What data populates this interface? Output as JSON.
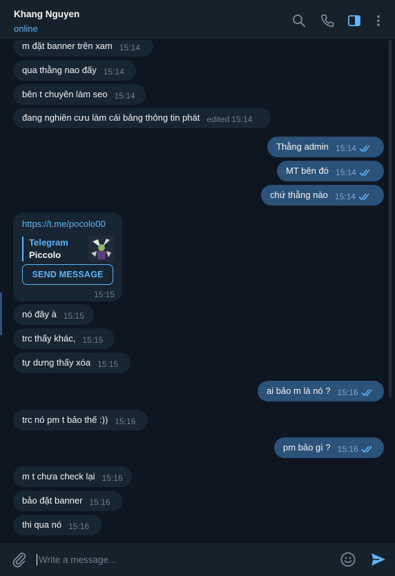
{
  "header": {
    "name": "Khang Nguyen",
    "status": "online",
    "icons": [
      "search-icon",
      "phone-icon",
      "sidebar-toggle-icon",
      "more-vertical-icon"
    ]
  },
  "messages": [
    {
      "dir": "in",
      "text": "m đặt banner trên xam",
      "time": "15:14"
    },
    {
      "dir": "in",
      "text": "qua thằng nao đấy",
      "time": "15:14"
    },
    {
      "dir": "in",
      "text": "bên t chuyên làm seo",
      "time": "15:14"
    },
    {
      "dir": "in",
      "text": "đang nghiên cưu làm cái bảng thông tin phát",
      "time": "edited 15:14"
    },
    {
      "dir": "out",
      "text": "Thằng admin",
      "time": "15:14",
      "read": true
    },
    {
      "dir": "out",
      "text": "MT bên đó",
      "time": "15:14",
      "read": true
    },
    {
      "dir": "out",
      "text": "chứ thằng nào",
      "time": "15:14",
      "read": true
    },
    {
      "dir": "in",
      "text": "nó đây à",
      "time": "15:15"
    },
    {
      "dir": "in",
      "text": "trc thấy khác,",
      "time": "15:15"
    },
    {
      "dir": "in",
      "text": "tự dưng thấy xóa",
      "time": "15:15"
    },
    {
      "dir": "out",
      "text": "ai bảo m là nó ?",
      "time": "15:16",
      "read": true
    },
    {
      "dir": "in",
      "text": "trc nó pm t bảo thế :))",
      "time": "15:16"
    },
    {
      "dir": "out",
      "text": "pm bảo gì ?",
      "time": "15:16",
      "read": true
    },
    {
      "dir": "in",
      "text": "m t chưa check lại",
      "time": "15:16"
    },
    {
      "dir": "in",
      "text": "bảo đặt banner",
      "time": "15:16"
    },
    {
      "dir": "in",
      "text": "thi qua nó",
      "time": "15:16"
    }
  ],
  "link_card": {
    "url": "https://t.me/pocolo00",
    "site": "Telegram",
    "title": "Piccolo",
    "button": "SEND MESSAGE",
    "time": "15:15"
  },
  "composer": {
    "placeholder": "Write a message..."
  },
  "colors": {
    "background": "#0e1621",
    "header": "#17212b",
    "incoming": "#182533",
    "outgoing": "#2b5278",
    "accent": "#5eb5f7"
  }
}
